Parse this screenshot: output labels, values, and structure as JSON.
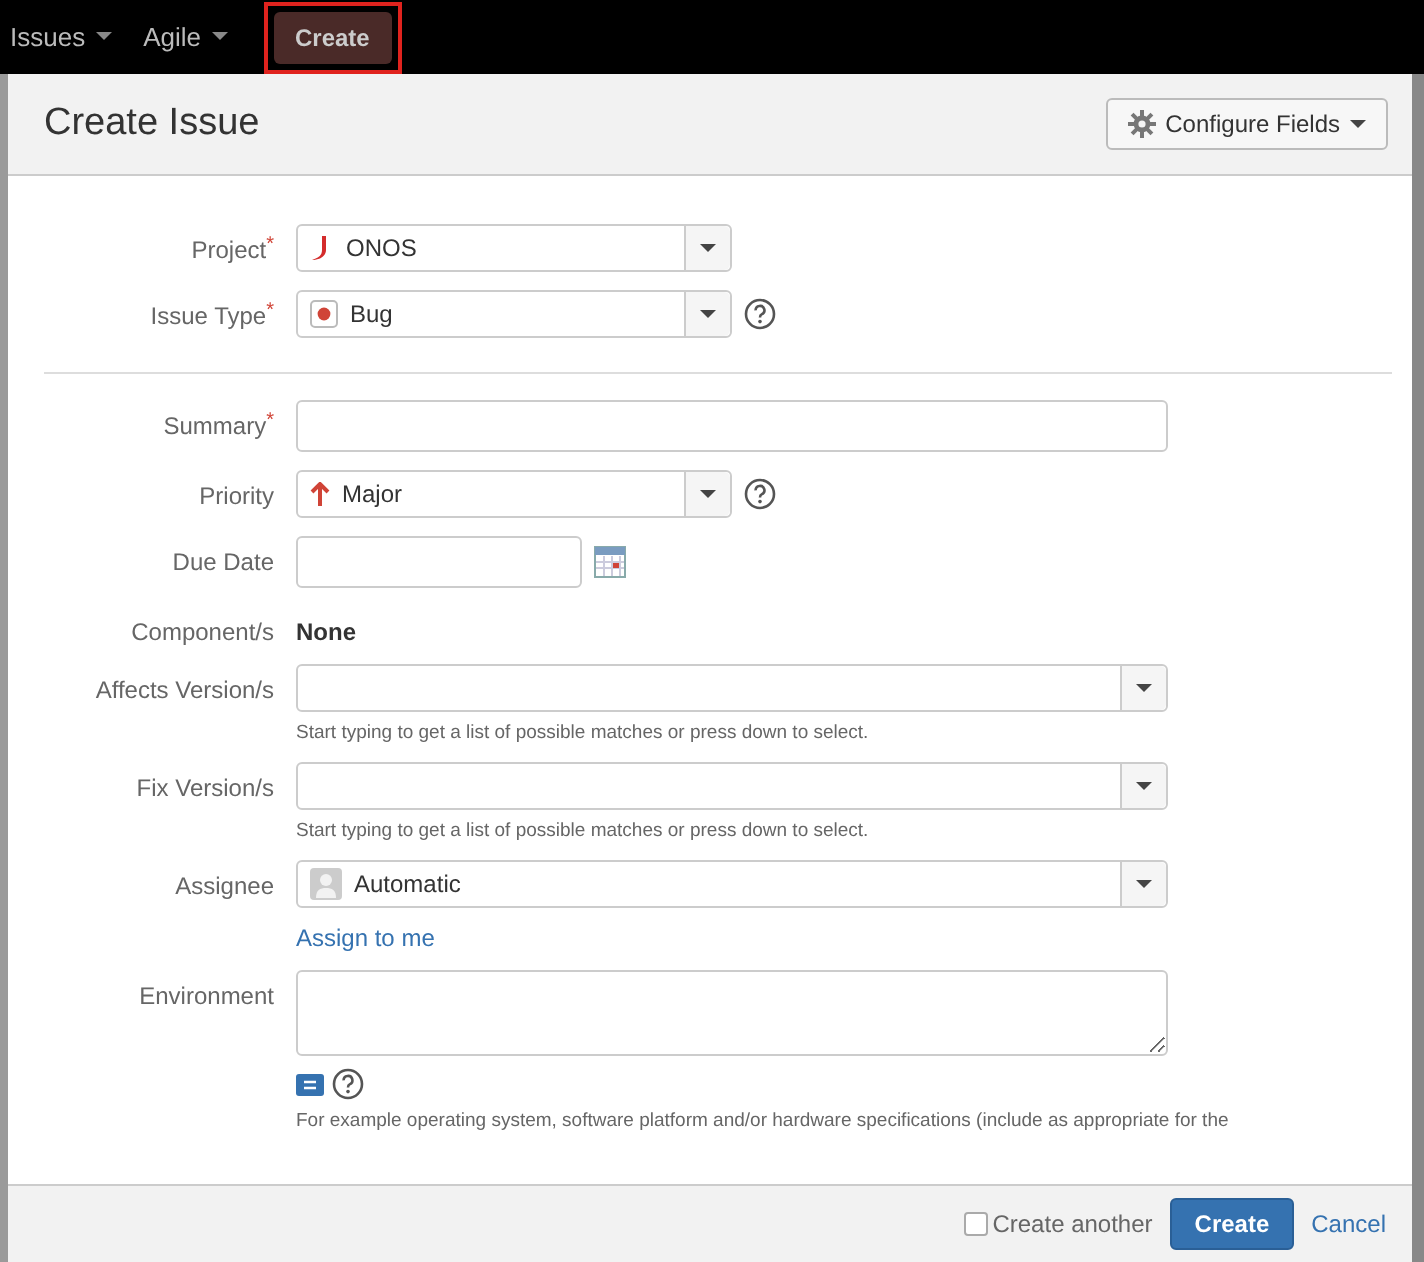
{
  "top_nav": {
    "items": [
      {
        "label": "Issues",
        "kind": "menu"
      },
      {
        "label": "Agile",
        "kind": "menu"
      },
      {
        "label": "Create",
        "kind": "button",
        "highlighted": true
      }
    ]
  },
  "dialog": {
    "title": "Create Issue",
    "configure_button": "Configure Fields",
    "sections": [
      {
        "fields": [
          {
            "label": "Project",
            "required_mark": "*",
            "kind": "select",
            "value": "ONOS"
          },
          {
            "label": "Issue Type",
            "required_mark": "*",
            "kind": "select",
            "value": "Bug",
            "help": true
          }
        ]
      },
      {
        "fields": [
          {
            "label": "Summary",
            "required_mark": "*",
            "kind": "text"
          },
          {
            "label": "Priority",
            "kind": "select",
            "value": "Major",
            "help": true
          },
          {
            "label": "Due Date",
            "kind": "date"
          },
          {
            "label": "Component/s",
            "kind": "static",
            "value": "None"
          },
          {
            "label": "Affects Version/s",
            "kind": "select",
            "hint": "Start typing to get a list of possible matches or press down to select."
          },
          {
            "label": "Fix Version/s",
            "kind": "select",
            "hint": "Start typing to get a list of possible matches or press down to select."
          },
          {
            "label": "Assignee",
            "kind": "select",
            "value": "Automatic",
            "link": "Assign to me"
          },
          {
            "label": "Environment",
            "kind": "textarea",
            "editor_tools": true,
            "hint": "For example operating system, software platform and/or hardware specifications (include as appropriate for the"
          }
        ]
      }
    ],
    "footer": {
      "create_another": {
        "label": "Create another",
        "checked": false
      },
      "submit": "Create",
      "cancel": "Cancel"
    }
  }
}
